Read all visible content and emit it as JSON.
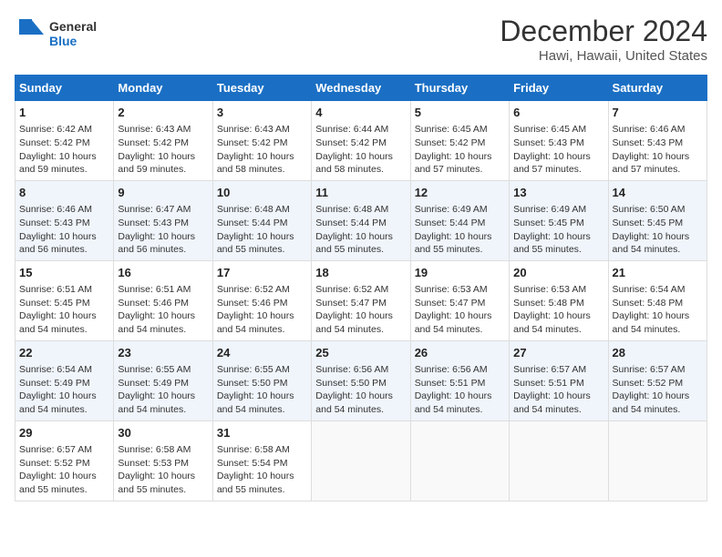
{
  "logo": {
    "line1": "General",
    "line2": "Blue"
  },
  "title": "December 2024",
  "subtitle": "Hawi, Hawaii, United States",
  "weekdays": [
    "Sunday",
    "Monday",
    "Tuesday",
    "Wednesday",
    "Thursday",
    "Friday",
    "Saturday"
  ],
  "weeks": [
    [
      {
        "day": "1",
        "info": "Sunrise: 6:42 AM\nSunset: 5:42 PM\nDaylight: 10 hours and 59 minutes."
      },
      {
        "day": "2",
        "info": "Sunrise: 6:43 AM\nSunset: 5:42 PM\nDaylight: 10 hours and 59 minutes."
      },
      {
        "day": "3",
        "info": "Sunrise: 6:43 AM\nSunset: 5:42 PM\nDaylight: 10 hours and 58 minutes."
      },
      {
        "day": "4",
        "info": "Sunrise: 6:44 AM\nSunset: 5:42 PM\nDaylight: 10 hours and 58 minutes."
      },
      {
        "day": "5",
        "info": "Sunrise: 6:45 AM\nSunset: 5:42 PM\nDaylight: 10 hours and 57 minutes."
      },
      {
        "day": "6",
        "info": "Sunrise: 6:45 AM\nSunset: 5:43 PM\nDaylight: 10 hours and 57 minutes."
      },
      {
        "day": "7",
        "info": "Sunrise: 6:46 AM\nSunset: 5:43 PM\nDaylight: 10 hours and 57 minutes."
      }
    ],
    [
      {
        "day": "8",
        "info": "Sunrise: 6:46 AM\nSunset: 5:43 PM\nDaylight: 10 hours and 56 minutes."
      },
      {
        "day": "9",
        "info": "Sunrise: 6:47 AM\nSunset: 5:43 PM\nDaylight: 10 hours and 56 minutes."
      },
      {
        "day": "10",
        "info": "Sunrise: 6:48 AM\nSunset: 5:44 PM\nDaylight: 10 hours and 55 minutes."
      },
      {
        "day": "11",
        "info": "Sunrise: 6:48 AM\nSunset: 5:44 PM\nDaylight: 10 hours and 55 minutes."
      },
      {
        "day": "12",
        "info": "Sunrise: 6:49 AM\nSunset: 5:44 PM\nDaylight: 10 hours and 55 minutes."
      },
      {
        "day": "13",
        "info": "Sunrise: 6:49 AM\nSunset: 5:45 PM\nDaylight: 10 hours and 55 minutes."
      },
      {
        "day": "14",
        "info": "Sunrise: 6:50 AM\nSunset: 5:45 PM\nDaylight: 10 hours and 54 minutes."
      }
    ],
    [
      {
        "day": "15",
        "info": "Sunrise: 6:51 AM\nSunset: 5:45 PM\nDaylight: 10 hours and 54 minutes."
      },
      {
        "day": "16",
        "info": "Sunrise: 6:51 AM\nSunset: 5:46 PM\nDaylight: 10 hours and 54 minutes."
      },
      {
        "day": "17",
        "info": "Sunrise: 6:52 AM\nSunset: 5:46 PM\nDaylight: 10 hours and 54 minutes."
      },
      {
        "day": "18",
        "info": "Sunrise: 6:52 AM\nSunset: 5:47 PM\nDaylight: 10 hours and 54 minutes."
      },
      {
        "day": "19",
        "info": "Sunrise: 6:53 AM\nSunset: 5:47 PM\nDaylight: 10 hours and 54 minutes."
      },
      {
        "day": "20",
        "info": "Sunrise: 6:53 AM\nSunset: 5:48 PM\nDaylight: 10 hours and 54 minutes."
      },
      {
        "day": "21",
        "info": "Sunrise: 6:54 AM\nSunset: 5:48 PM\nDaylight: 10 hours and 54 minutes."
      }
    ],
    [
      {
        "day": "22",
        "info": "Sunrise: 6:54 AM\nSunset: 5:49 PM\nDaylight: 10 hours and 54 minutes."
      },
      {
        "day": "23",
        "info": "Sunrise: 6:55 AM\nSunset: 5:49 PM\nDaylight: 10 hours and 54 minutes."
      },
      {
        "day": "24",
        "info": "Sunrise: 6:55 AM\nSunset: 5:50 PM\nDaylight: 10 hours and 54 minutes."
      },
      {
        "day": "25",
        "info": "Sunrise: 6:56 AM\nSunset: 5:50 PM\nDaylight: 10 hours and 54 minutes."
      },
      {
        "day": "26",
        "info": "Sunrise: 6:56 AM\nSunset: 5:51 PM\nDaylight: 10 hours and 54 minutes."
      },
      {
        "day": "27",
        "info": "Sunrise: 6:57 AM\nSunset: 5:51 PM\nDaylight: 10 hours and 54 minutes."
      },
      {
        "day": "28",
        "info": "Sunrise: 6:57 AM\nSunset: 5:52 PM\nDaylight: 10 hours and 54 minutes."
      }
    ],
    [
      {
        "day": "29",
        "info": "Sunrise: 6:57 AM\nSunset: 5:52 PM\nDaylight: 10 hours and 55 minutes."
      },
      {
        "day": "30",
        "info": "Sunrise: 6:58 AM\nSunset: 5:53 PM\nDaylight: 10 hours and 55 minutes."
      },
      {
        "day": "31",
        "info": "Sunrise: 6:58 AM\nSunset: 5:54 PM\nDaylight: 10 hours and 55 minutes."
      },
      null,
      null,
      null,
      null
    ]
  ]
}
